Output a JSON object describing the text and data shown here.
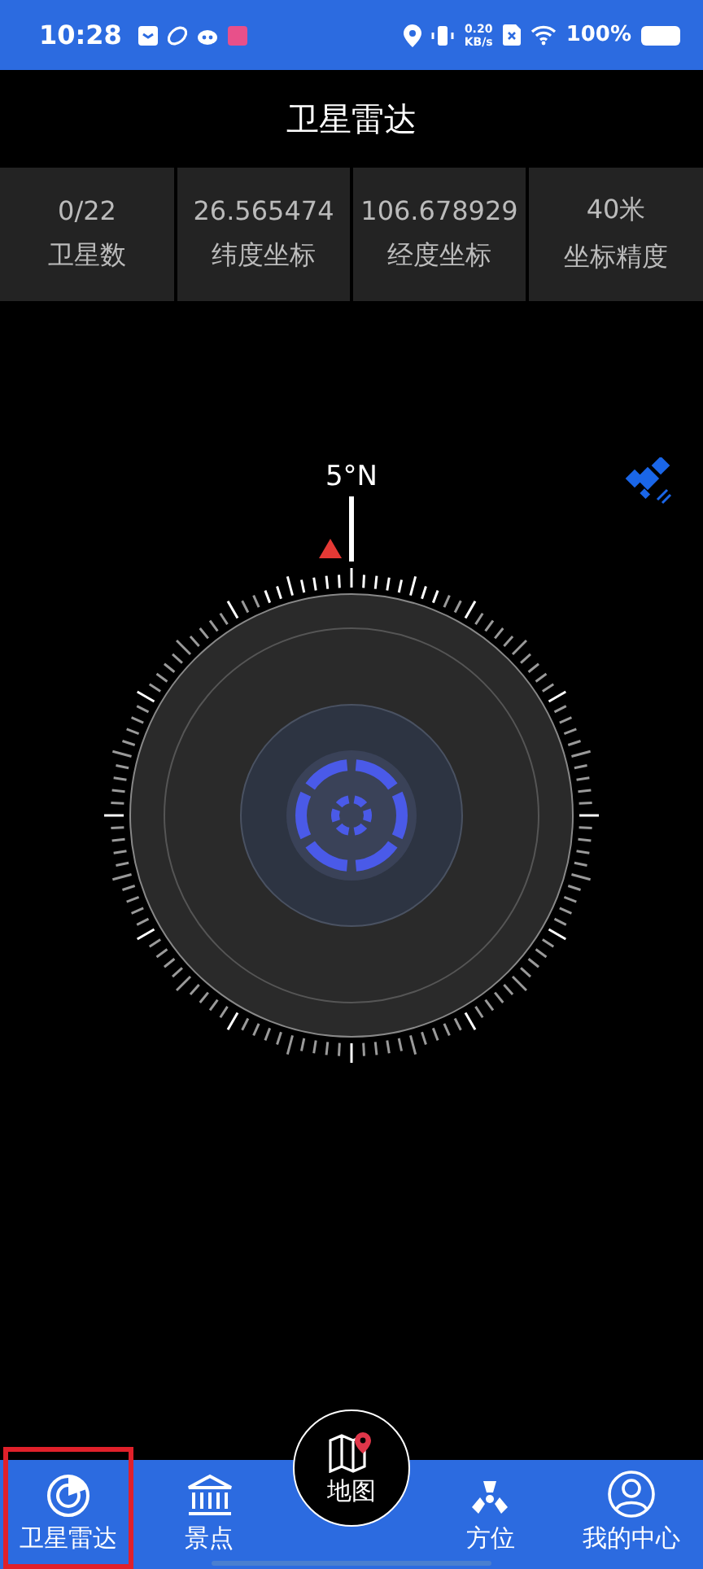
{
  "status_bar": {
    "time": "10:28",
    "speed_value": "0.20",
    "speed_unit": "KB/s",
    "battery": "100%"
  },
  "title": "卫星雷达",
  "stats": [
    {
      "value": "0/22",
      "label": "卫星数"
    },
    {
      "value": "26.565474",
      "label": "纬度坐标"
    },
    {
      "value": "106.678929",
      "label": "经度坐标"
    },
    {
      "value": "40米",
      "label": "坐标精度"
    }
  ],
  "compass": {
    "heading": "5°N"
  },
  "nav": [
    {
      "kind": "radar",
      "label": "卫星雷达",
      "selected": true
    },
    {
      "kind": "bank",
      "label": "景点",
      "selected": false
    },
    {
      "kind": "map",
      "label": "地图",
      "selected": false
    },
    {
      "kind": "direction",
      "label": "方位",
      "selected": false
    },
    {
      "kind": "user",
      "label": "我的中心",
      "selected": false
    }
  ]
}
